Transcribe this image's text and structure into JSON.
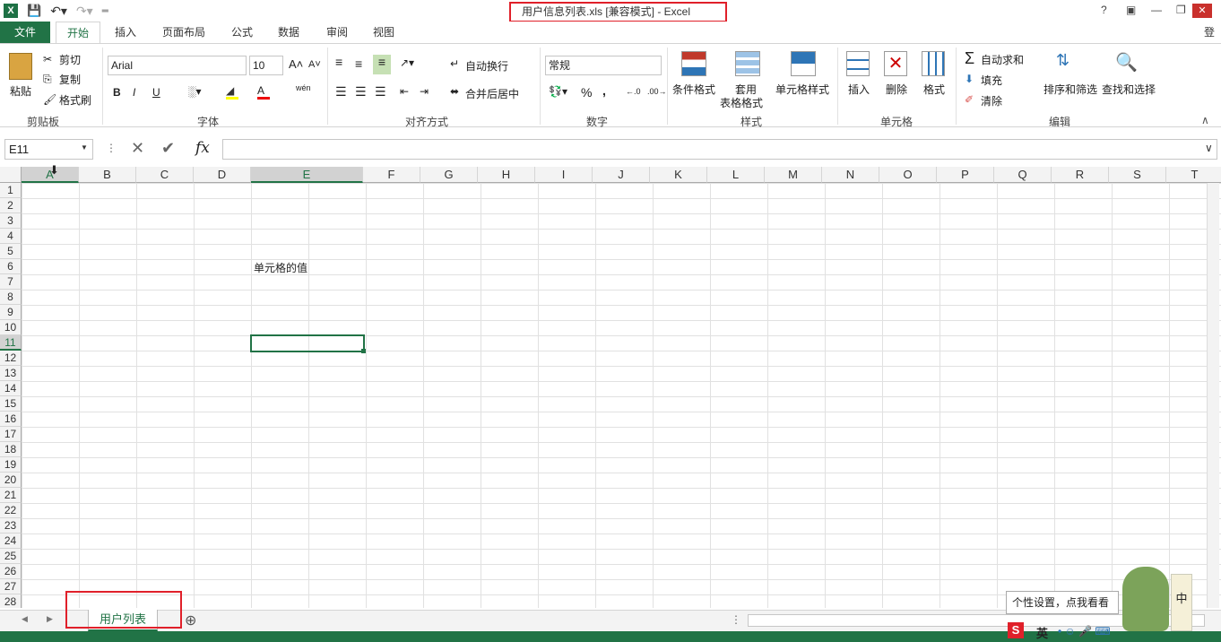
{
  "window": {
    "title": "用户信息列表.xls  [兼容模式] - Excel",
    "help": "?",
    "login": "登"
  },
  "tabs": [
    "文件",
    "开始",
    "插入",
    "页面布局",
    "公式",
    "数据",
    "审阅",
    "视图"
  ],
  "ribbon": {
    "clipboard": {
      "label": "剪贴板",
      "paste": "粘贴",
      "cut": "剪切",
      "copy": "复制",
      "format_painter": "格式刷"
    },
    "font": {
      "label": "字体",
      "name": "Arial",
      "size": "10",
      "bold": "B",
      "italic": "I",
      "underline": "U",
      "phonetic": "wén"
    },
    "alignment": {
      "label": "对齐方式",
      "wrap": "自动换行",
      "merge": "合并后居中"
    },
    "number": {
      "label": "数字",
      "format": "常规",
      "percent": "%",
      "comma": ","
    },
    "styles": {
      "label": "样式",
      "conditional": "条件格式",
      "table1": "套用",
      "table2": "表格格式",
      "cell_styles": "单元格样式"
    },
    "cells": {
      "label": "单元格",
      "insert": "插入",
      "delete": "删除",
      "format": "格式"
    },
    "editing": {
      "label": "编辑",
      "autosum": "自动求和",
      "fill": "填充",
      "clear": "清除",
      "sort": "排序和筛选",
      "find": "查找和选择"
    }
  },
  "formula_bar": {
    "name_box": "E11",
    "fx": "fx",
    "value": ""
  },
  "columns": [
    "A",
    "B",
    "C",
    "D",
    "E",
    "F",
    "G",
    "H",
    "I",
    "J",
    "K",
    "L",
    "M",
    "N",
    "O",
    "P",
    "Q",
    "R",
    "S",
    "T"
  ],
  "rows": [
    "1",
    "2",
    "3",
    "4",
    "5",
    "6",
    "7",
    "8",
    "9",
    "10",
    "11",
    "12",
    "13",
    "14",
    "15",
    "16",
    "17",
    "18",
    "19",
    "20",
    "21",
    "22",
    "23",
    "24",
    "25",
    "26",
    "27",
    "28"
  ],
  "cell_E6": "单元格的值",
  "sheet_tab": "用户列表",
  "tooltip": "个性设置，点我看看",
  "ime": "英",
  "overlay_char": "中",
  "colors": {
    "accent": "#217346",
    "highlight": "#e0202a"
  }
}
